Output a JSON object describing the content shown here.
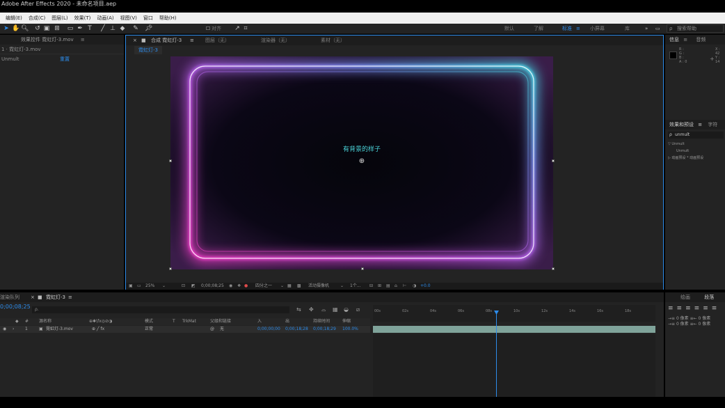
{
  "titlebar": {
    "text": "Adobe After Effects 2020 - 未命名项目.aep"
  },
  "menubar": {
    "items": [
      "编辑(E)",
      "合成(C)",
      "图层(L)",
      "效果(T)",
      "动画(A)",
      "视图(V)",
      "窗口",
      "帮助(H)"
    ]
  },
  "toolbar": {
    "snap_label": "对齐",
    "workspaces": [
      "默认",
      "了解",
      "标准",
      "小屏幕",
      "库"
    ],
    "active_workspace": "标准",
    "help_search": "搜索帮助"
  },
  "left_panel": {
    "tab_label": "效果控件 霓虹灯-3.mov",
    "layer_label": "1 · 霓虹灯-3.mov",
    "effect_name": "Unmult",
    "reset_label": "重置"
  },
  "comp_panel": {
    "tabs": [
      "合成 霓虹灯-3",
      "图层（无）",
      "渲染器（无）",
      "素材（无）"
    ],
    "subtab": "霓虹灯-3",
    "overlay_text": "有背景的样子",
    "status": {
      "zoom": "25%",
      "timecode": "0;00;08;25",
      "resolution": "四分之一",
      "camera": "活动摄像机",
      "views": "1个...",
      "exposure": "+0.0"
    }
  },
  "right_panel": {
    "tabs": [
      "信息",
      "音频"
    ],
    "rgb": [
      "R :",
      "G :",
      "B :",
      "A : 0"
    ],
    "xy": [
      "X : 42",
      "Y : 14"
    ],
    "effects_tab": "效果和预设",
    "effects_tab2": "字符",
    "effects_search": "unmult",
    "tree": [
      "▽ Unmult",
      "   Unmult",
      "▷ 动画预设 * 动画预设"
    ]
  },
  "timeline": {
    "tabs": [
      "渲染队列",
      "霓虹灯-3"
    ],
    "current_time": "0;00;08;25",
    "search_placeholder": "ρ.",
    "columns": [
      "#",
      "源名称",
      "模式",
      "T",
      "TrkMat",
      "父级和链接",
      "入",
      "出",
      "持续时间",
      "伸缩"
    ],
    "row": {
      "index": "1",
      "name": "霓虹灯-3.mov",
      "mode": "正常",
      "parent": "无",
      "in": "0;00;00;00",
      "out": "0;00;18;28",
      "duration": "0;00;18;29",
      "stretch": "100.0%"
    },
    "ruler_ticks": [
      "00s",
      "02s",
      "04s",
      "06s",
      "08s",
      "10s",
      "12s",
      "14s",
      "16s",
      "18s"
    ]
  },
  "align_panel": {
    "tabs": [
      "绘画",
      "段落"
    ],
    "rows": [
      "→≡ 0 像素   ≡← 0 像素",
      "→≡ 0 像素   ≡← 0 像素"
    ]
  }
}
